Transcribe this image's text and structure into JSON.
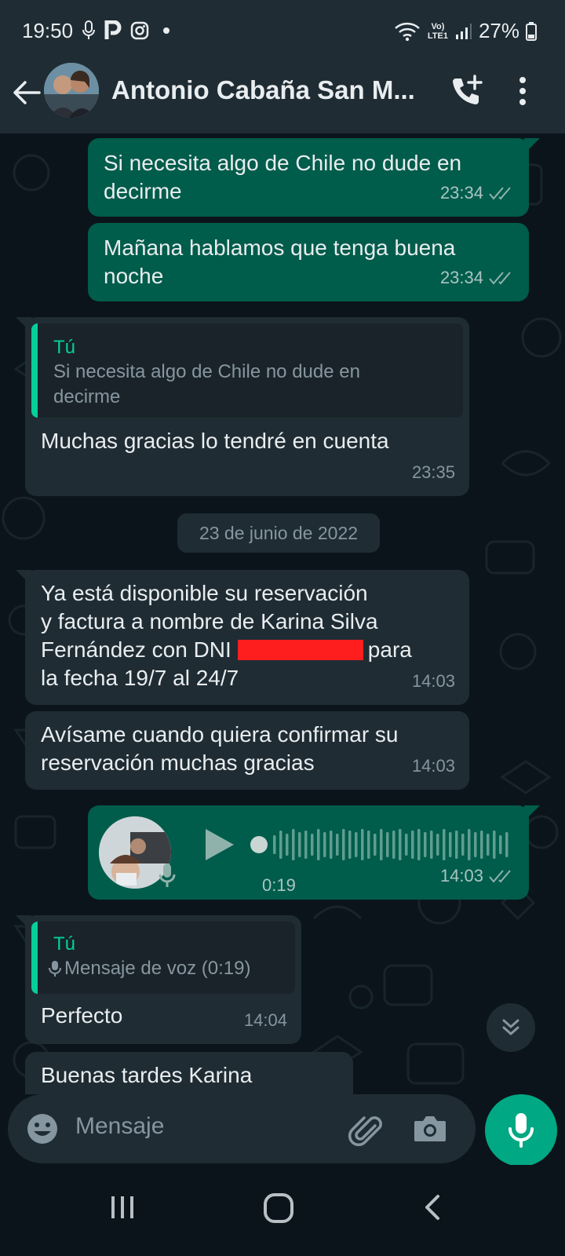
{
  "status_bar": {
    "time": "19:50",
    "battery": "27%",
    "network_label": "Vo) LTE1"
  },
  "header": {
    "contact_name": "Antonio Cabaña San M...",
    "back_icon": "back-arrow-icon",
    "call_icon": "add-call-icon",
    "menu_icon": "more-vertical-icon"
  },
  "messages": [
    {
      "direction": "out",
      "text": "Si necesita algo de Chile no dude en decirme",
      "time": "23:34",
      "status": "read"
    },
    {
      "direction": "out",
      "text": "Mañana hablamos que tenga buena noche",
      "time": "23:34",
      "status": "read"
    },
    {
      "direction": "in",
      "quote_author": "Tú",
      "quote_text": "Si necesita algo de Chile no dude en decirme",
      "text": "Muchas gracias lo tendré en cuenta",
      "time": "23:35"
    },
    {
      "direction": "in",
      "text_before": "Ya está disponible su reservación\ny factura a nombre de Karina Silva\nFernández con DNI",
      "text_after": "para",
      "text_last": "la fecha 19/7 al 24/7",
      "time": "14:03"
    },
    {
      "direction": "in",
      "text": "Avísame cuando quiera confirmar su reservación muchas gracias",
      "time": "14:03"
    },
    {
      "direction": "out",
      "type": "voice",
      "duration": "0:19",
      "time": "14:03",
      "status": "read"
    },
    {
      "direction": "in",
      "quote_author": "Tú",
      "quote_text": "Mensaje de voz (0:19)",
      "text": "Perfecto",
      "time": "14:04"
    },
    {
      "direction": "in",
      "text": "Buenas tardes Karina"
    }
  ],
  "date_separator": "23 de junio de 2022",
  "composer": {
    "placeholder": "Mensaje",
    "emoji_icon": "emoji-icon",
    "attach_icon": "paperclip-icon",
    "camera_icon": "camera-icon",
    "mic_icon": "mic-icon"
  },
  "colors": {
    "outgoing": "#005c4b",
    "incoming": "#1f2c34",
    "accent": "#00a884",
    "quote_accent": "#06cf9c",
    "read_ticks": "#8696a0",
    "redaction": "#ff1e1e"
  }
}
